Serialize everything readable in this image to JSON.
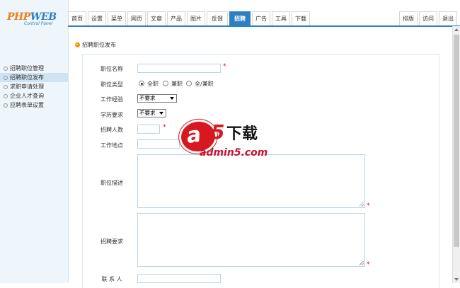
{
  "logo": {
    "line1": "PHP",
    "line1b": "WEB",
    "line2": "Control Panel"
  },
  "sidebar": {
    "items": [
      {
        "label": "招聘职位管理",
        "active": false
      },
      {
        "label": "招聘职位发布",
        "active": true
      },
      {
        "label": "求职申请处理",
        "active": false
      },
      {
        "label": "企业人才查询",
        "active": false
      },
      {
        "label": "应聘表单设置",
        "active": false
      }
    ]
  },
  "topnav": {
    "tabs": [
      "首页",
      "设置",
      "菜单",
      "网页",
      "文章",
      "产品",
      "图片",
      "反馈",
      "招聘",
      "广告",
      "工具",
      "下载"
    ],
    "active_tab": "招聘",
    "right": [
      "排版",
      "访问",
      "退出"
    ]
  },
  "breadcrumb": "招聘职位发布",
  "form": {
    "job_name_label": "职位名称",
    "job_type_label": "职位类型",
    "job_type_options": [
      "全职",
      "兼职",
      "全/兼职"
    ],
    "job_type_selected": "全职",
    "experience_label": "工作经验",
    "experience_value": "不要求",
    "education_label": "学历要求",
    "education_value": "不要求",
    "headcount_label": "招聘人数",
    "location_label": "工作地点",
    "description_label": "职位描述",
    "requirements_label": "招聘要求",
    "contact_label": "联 系 人",
    "required_mark": "*"
  },
  "watermark": {
    "brand_a": "a",
    "brand_5": "5",
    "brand_dl": "下载",
    "site": "admin5.com"
  },
  "colors": {
    "accent": "#2c7fc0",
    "required": "#e00000",
    "sidebar_bg": "#eef5fb",
    "watermark": "#d71820"
  }
}
